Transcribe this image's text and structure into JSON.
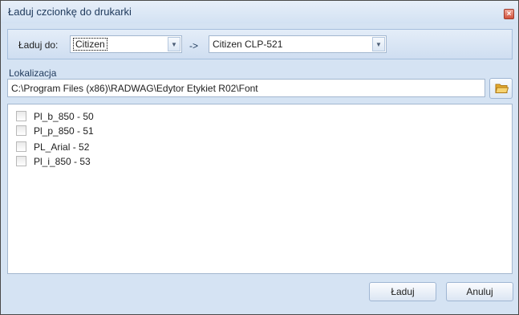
{
  "window": {
    "title": "Ładuj czcionkę do drukarki",
    "close_glyph": "×"
  },
  "toolbar": {
    "load_to_label": "Ładuj do:",
    "source_printer": "Citizen",
    "arrow": "->",
    "target_printer": "Citizen CLP-521",
    "dropdown_glyph": "▼"
  },
  "location": {
    "label": "Lokalizacja",
    "path": "C:\\Program Files (x86)\\RADWAG\\Edytor Etykiet R02\\Font"
  },
  "fonts": [
    {
      "label": "Pl_b_850 - 50",
      "checked": false
    },
    {
      "label": "Pl_p_850 - 51",
      "checked": false
    },
    {
      "label": "PL_Arial - 52",
      "checked": false
    },
    {
      "label": "Pl_i_850 - 53",
      "checked": false
    }
  ],
  "buttons": {
    "load": "Ładuj",
    "cancel": "Anuluj"
  },
  "colors": {
    "accent": "#1e395b",
    "close": "#d2513c",
    "folder": "#f2c14e"
  }
}
